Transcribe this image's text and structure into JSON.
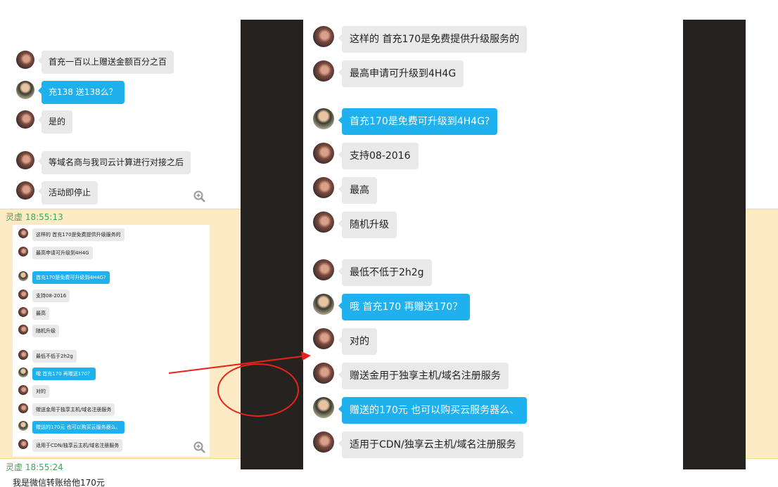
{
  "left_chat": [
    {
      "text": "首充一百以上赠送金额百分之百",
      "me": false
    },
    {
      "text": "充138 送138么？",
      "me": true
    },
    {
      "text": "是的",
      "me": false
    },
    {
      "text": "等域名商与我司云计算进行对接之后",
      "me": false
    },
    {
      "text": "活动即停止",
      "me": false
    }
  ],
  "messages": [
    {
      "sender": "灵虚",
      "time": "18:55:13"
    },
    {
      "sender": "灵虚",
      "time": "18:55:24",
      "text": "我是微信转账给他170元"
    }
  ],
  "screenshot_chat": [
    {
      "text": "这样的 首充170是免费提供升级服务的",
      "me": false
    },
    {
      "text": "最高申请可升级到4H4G",
      "me": false
    },
    {
      "text": "首充170是免费可升级到4H4G?",
      "me": true
    },
    {
      "text": "支持08-2016",
      "me": false
    },
    {
      "text": "最高",
      "me": false
    },
    {
      "text": "随机升级",
      "me": false
    },
    {
      "text": "最低不低于2h2g",
      "me": false
    },
    {
      "text": "哦 首充170 再赠送170？",
      "me": true
    },
    {
      "text": "对的",
      "me": false
    },
    {
      "text": "赠送金用于独享主机/域名注册服务",
      "me": false
    },
    {
      "text": "赠送的170元 也可以购买云服务器么、",
      "me": true
    },
    {
      "text": "适用于CDN/独享云主机/域名注册服务",
      "me": false
    }
  ],
  "icons": {
    "zoom": "zoom-in-icon",
    "arrow": "red-arrow",
    "circle": "red-circle"
  },
  "colors": {
    "band": "#fcebc5",
    "bubble_me": "#1eb1ee",
    "bubble_other": "#e9e9e9",
    "annotation": "#e8221b"
  }
}
